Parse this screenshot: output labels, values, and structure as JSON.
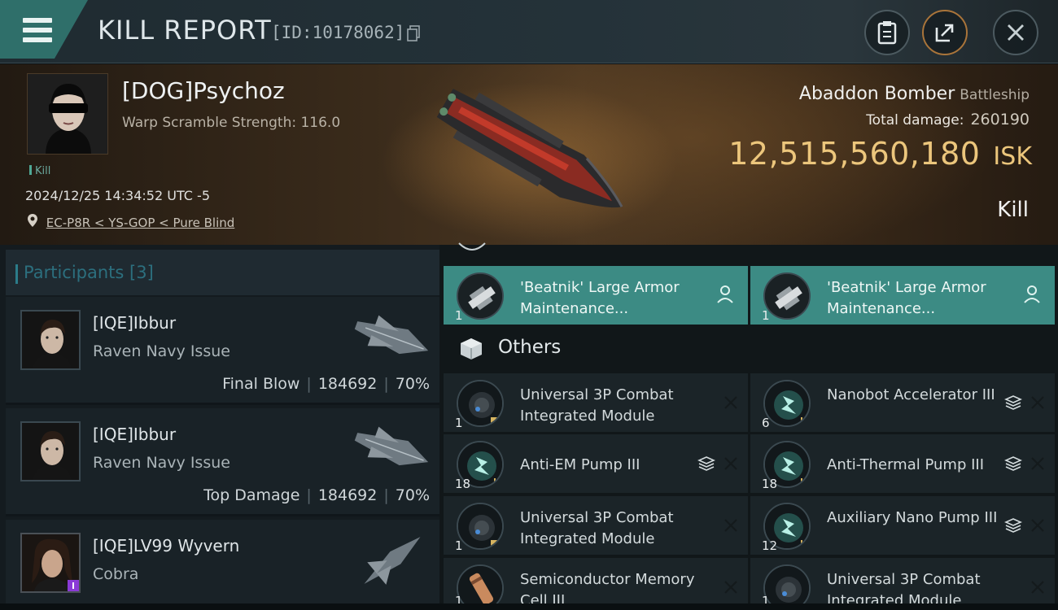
{
  "titlebar": {
    "title": "KILL REPORT",
    "report_id": "[ID:10178062]"
  },
  "victim": {
    "name": "[DOG]Psychoz",
    "warp_scramble": "Warp Scramble Strength: 116.0",
    "kill_tag": "Kill",
    "datetime": "2024/12/25 14:34:52 UTC -5",
    "location": "EC-P8R < YS-GOP < Pure Blind",
    "ship_name": "Abaddon Bomber",
    "ship_class": "Battleship",
    "total_damage_label": "Total damage:",
    "total_damage_value": "260190",
    "isk_value": "12,515,560,180",
    "isk_unit": "ISK",
    "result": "Kill"
  },
  "participants": {
    "label": "Participants",
    "count": "[3]",
    "rows": [
      {
        "name": "[IQE]Ibbur",
        "ship": "Raven Navy Issue",
        "role": "Final Blow",
        "damage": "184692",
        "percent": "70%"
      },
      {
        "name": "[IQE]Ibbur",
        "ship": "Raven Navy Issue",
        "role": "Top Damage",
        "damage": "184692",
        "percent": "70%"
      },
      {
        "name": "[IQE]LV99 Wyvern",
        "ship": "Cobra"
      }
    ]
  },
  "fitting": {
    "highlighted": [
      {
        "name": "'Beatnik' Large Armor Maintenance...",
        "qty": "1"
      },
      {
        "name": "'Beatnik' Large Armor Maintenance...",
        "qty": "1"
      }
    ],
    "others_label": "Others",
    "others": [
      {
        "name": "Universal 3P Combat Integrated Module",
        "qty": "1"
      },
      {
        "name": "Nanobot Accelerator III",
        "qty": "6"
      },
      {
        "name": "Anti-EM Pump III",
        "qty": "18"
      },
      {
        "name": "Anti-Thermal Pump III",
        "qty": "18"
      },
      {
        "name": "Universal 3P Combat Integrated Module",
        "qty": "1"
      },
      {
        "name": "Auxiliary Nano Pump III",
        "qty": "12"
      },
      {
        "name": "Semiconductor Memory Cell III",
        "qty": "1"
      },
      {
        "name": "Universal 3P Combat Integrated Module",
        "qty": "1"
      }
    ]
  },
  "colors": {
    "accent_teal": "#3c8b84",
    "isk_gold": "#ecc67c",
    "participants_blue": "#2c6f7e"
  }
}
